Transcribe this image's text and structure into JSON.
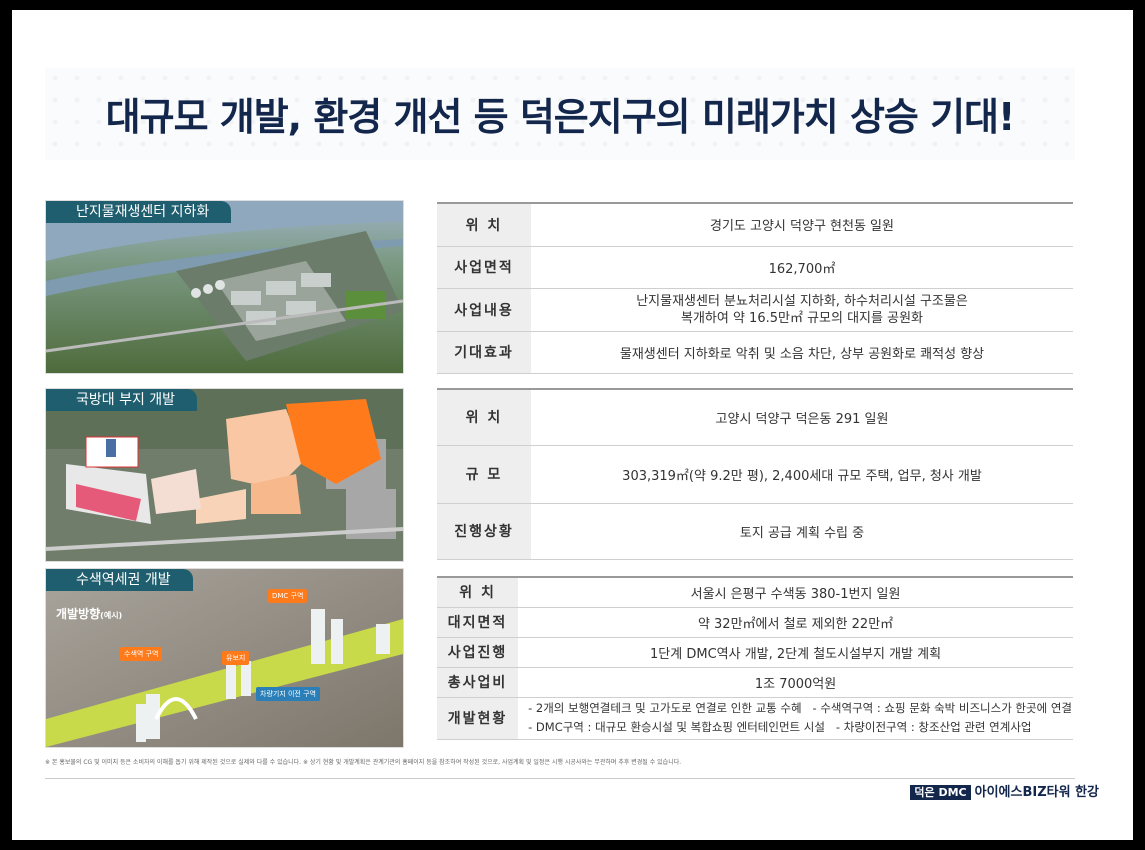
{
  "title": "대규모 개발, 환경 개선 등 덕은지구의 미래가치 상승 기대!",
  "sections": [
    {
      "tag": "난지물재생센터 지하화",
      "rows": [
        {
          "key": "위       치",
          "value": "경기도 고양시 덕양구 현천동 일원"
        },
        {
          "key": "사업면적",
          "value": "162,700㎡"
        },
        {
          "key": "사업내용",
          "value": "난지물재생센터 분뇨처리시설 지하화, 하수처리시설 구조물은\n복개하여 약 16.5만㎡ 규모의 대지를 공원화"
        },
        {
          "key": "기대효과",
          "value": "물재생센터 지하화로 악취 및 소음 차단, 상부 공원화로 쾌적성 향상"
        }
      ]
    },
    {
      "tag": "국방대 부지 개발",
      "rows": [
        {
          "key": "위       치",
          "value": "고양시 덕양구 덕은동 291 일원"
        },
        {
          "key": "규       모",
          "value": "303,319㎡(약 9.2만 평), 2,400세대 규모 주택, 업무, 청사 개발"
        },
        {
          "key": "진행상황",
          "value": "토지 공급 계획 수립 중"
        }
      ]
    },
    {
      "tag": "수색역세권 개발",
      "map_label": "개발방향",
      "map_label_sub": "(예시)",
      "map_tags": [
        "DMC 구역",
        "수색역 구역",
        "유보지",
        "차량기지 이전 구역"
      ],
      "rows": [
        {
          "key": "위       치",
          "value": "서울시 은평구 수색동 380-1번지 일원"
        },
        {
          "key": "대지면적",
          "value": "약 32만㎡에서 철로 제외한 22만㎡"
        },
        {
          "key": "사업진행",
          "value": "1단계 DMC역사 개발, 2단계 철도시설부지 개발 계획"
        },
        {
          "key": "총사업비",
          "value": "1조 7000억원"
        },
        {
          "key": "개발현황",
          "value": "- 2개의 보행연결테크 및 고가도로 연결로 인한 교통 수혜   - 수색역구역 : 쇼핑 문화 숙박 비즈니스가 한곳에 연결\n- DMC구역 : 대규모 환승시설 및 복합쇼핑 엔터테인먼트 시설   - 차량이전구역 : 창조산업 관련 연계사업"
        }
      ]
    }
  ],
  "footnote": "※ 본 홍보물의 CG 및 이미지 등은 소비자의 이해를 돕기 위해 제작된 것으로 실제와 다를 수 있습니다. ※ 상기 현황 및 개발계획은 관계기관의 홈페이지 등을 참조하여 작성된 것으로, 사업계획 및 일정은 시행 시공사와는 무관하며 추후 변경될 수 있습니다.",
  "brand": {
    "box": "덕은 DMC",
    "name": "아이에스BIZ타워 한강"
  },
  "colors": {
    "navy": "#13264b",
    "teal_tag": "#1f5e6f",
    "orange": "#ff7a1a",
    "key_bg": "#eeeeee"
  }
}
